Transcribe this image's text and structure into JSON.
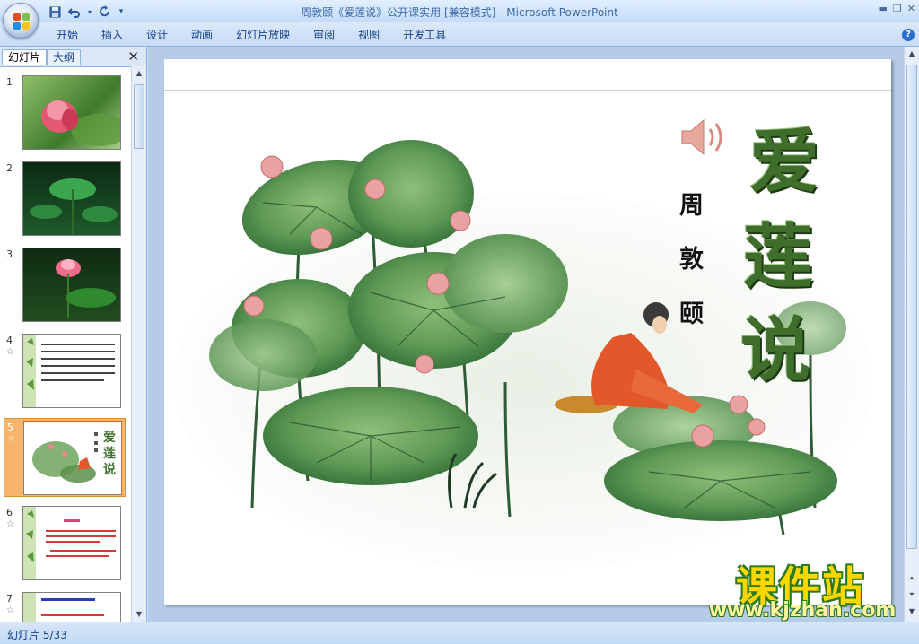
{
  "window": {
    "title": "周敦颐《爱莲说》公开课实用 [兼容模式] - Microsoft PowerPoint"
  },
  "quick_access": [
    {
      "name": "save-icon",
      "glyph": "■"
    },
    {
      "name": "undo-icon",
      "glyph": "↶"
    },
    {
      "name": "redo-icon",
      "glyph": "↻"
    }
  ],
  "ribbon": {
    "tabs": [
      "开始",
      "插入",
      "设计",
      "动画",
      "幻灯片放映",
      "审阅",
      "视图",
      "开发工具"
    ]
  },
  "pane": {
    "tab_slides": "幻灯片",
    "tab_outline": "大纲",
    "thumbnails": [
      {
        "num": "1",
        "star": ""
      },
      {
        "num": "2",
        "star": ""
      },
      {
        "num": "3",
        "star": ""
      },
      {
        "num": "4",
        "star": "☆"
      },
      {
        "num": "5",
        "star": "☆"
      },
      {
        "num": "6",
        "star": "☆"
      },
      {
        "num": "7",
        "star": "☆"
      }
    ]
  },
  "slide": {
    "title_chars": [
      "爱",
      "莲",
      "说"
    ],
    "author_chars": [
      "周",
      "敦",
      "颐"
    ]
  },
  "watermark": {
    "title": "课件站",
    "url": "www.kjzhan.com"
  },
  "status": {
    "slide_indicator": "幻灯片 5/33"
  }
}
